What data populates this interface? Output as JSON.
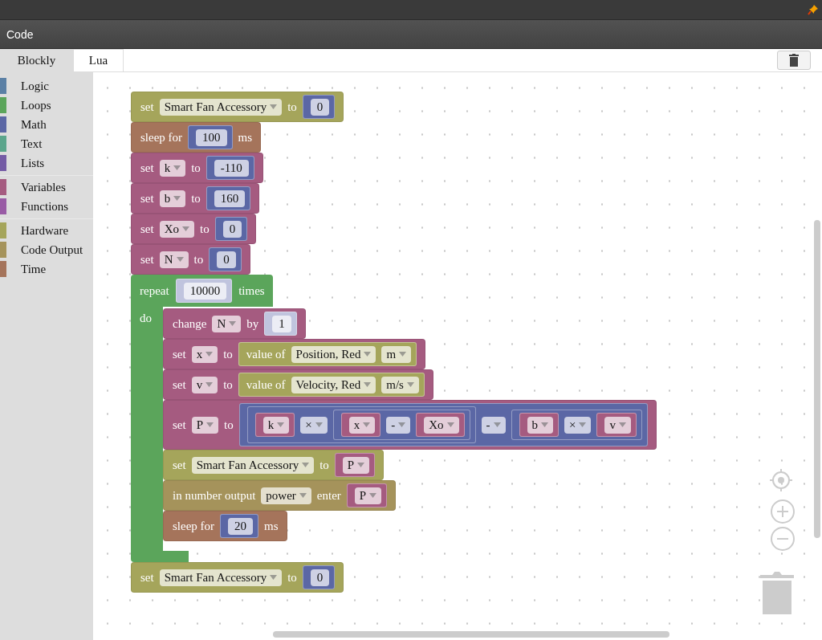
{
  "window": {
    "title": "Code"
  },
  "tabs": [
    {
      "label": "Blockly",
      "selected": true
    },
    {
      "label": "Lua",
      "selected": false
    }
  ],
  "sidebar": {
    "groups": [
      {
        "items": [
          {
            "label": "Logic",
            "color": "#5b80a5"
          },
          {
            "label": "Loops",
            "color": "#5ba55b"
          },
          {
            "label": "Math",
            "color": "#5b67a5"
          },
          {
            "label": "Text",
            "color": "#5ba58c"
          },
          {
            "label": "Lists",
            "color": "#745ba5"
          }
        ]
      },
      {
        "items": [
          {
            "label": "Variables",
            "color": "#a55b80"
          },
          {
            "label": "Functions",
            "color": "#995ba5"
          }
        ]
      },
      {
        "items": [
          {
            "label": "Hardware",
            "color": "#a5a55b"
          },
          {
            "label": "Code Output",
            "color": "#a5935b"
          },
          {
            "label": "Time",
            "color": "#a5745b"
          }
        ]
      }
    ]
  },
  "workspace": {
    "blocks": [
      {
        "kind": "statement",
        "color": "#a5a55b",
        "parts": [
          {
            "kind": "label",
            "text": "set"
          },
          {
            "kind": "dropdown",
            "text": "Smart Fan Accessory"
          },
          {
            "kind": "label",
            "text": "to"
          },
          {
            "kind": "value",
            "block": {
              "color": "#5b67a5",
              "parts": [
                {
                  "kind": "field",
                  "text": "0"
                }
              ]
            }
          }
        ]
      },
      {
        "kind": "statement",
        "color": "#a5745b",
        "parts": [
          {
            "kind": "label",
            "text": "sleep for"
          },
          {
            "kind": "value",
            "block": {
              "color": "#5b67a5",
              "parts": [
                {
                  "kind": "field",
                  "text": "100"
                }
              ]
            }
          },
          {
            "kind": "label",
            "text": "ms"
          }
        ]
      },
      {
        "kind": "statement",
        "color": "#a55b80",
        "parts": [
          {
            "kind": "label",
            "text": "set"
          },
          {
            "kind": "dropdown",
            "text": "k"
          },
          {
            "kind": "label",
            "text": "to"
          },
          {
            "kind": "value",
            "block": {
              "color": "#5b67a5",
              "parts": [
                {
                  "kind": "field",
                  "text": "-110"
                }
              ]
            }
          }
        ]
      },
      {
        "kind": "statement",
        "color": "#a55b80",
        "parts": [
          {
            "kind": "label",
            "text": "set"
          },
          {
            "kind": "dropdown",
            "text": "b"
          },
          {
            "kind": "label",
            "text": "to"
          },
          {
            "kind": "value",
            "block": {
              "color": "#5b67a5",
              "parts": [
                {
                  "kind": "field",
                  "text": "160"
                }
              ]
            }
          }
        ]
      },
      {
        "kind": "statement",
        "color": "#a55b80",
        "parts": [
          {
            "kind": "label",
            "text": "set"
          },
          {
            "kind": "dropdown",
            "text": "Xo"
          },
          {
            "kind": "label",
            "text": "to"
          },
          {
            "kind": "value",
            "block": {
              "color": "#5b67a5",
              "parts": [
                {
                  "kind": "field",
                  "text": "0"
                }
              ]
            }
          }
        ]
      },
      {
        "kind": "statement",
        "color": "#a55b80",
        "parts": [
          {
            "kind": "label",
            "text": "set"
          },
          {
            "kind": "dropdown",
            "text": "N"
          },
          {
            "kind": "label",
            "text": "to"
          },
          {
            "kind": "value",
            "block": {
              "color": "#5b67a5",
              "parts": [
                {
                  "kind": "field",
                  "text": "0"
                }
              ]
            }
          }
        ]
      },
      {
        "kind": "loop",
        "color": "#5ba55b",
        "parts": [
          {
            "kind": "label",
            "text": "repeat"
          },
          {
            "kind": "value",
            "block": {
              "color": "#c0c4de",
              "parts": [
                {
                  "kind": "field",
                  "text": "10000"
                }
              ]
            }
          },
          {
            "kind": "label",
            "text": "times"
          }
        ],
        "do_label": "do",
        "body": [
          {
            "kind": "statement",
            "color": "#a55b80",
            "parts": [
              {
                "kind": "label",
                "text": "change"
              },
              {
                "kind": "dropdown",
                "text": "N"
              },
              {
                "kind": "label",
                "text": "by"
              },
              {
                "kind": "value",
                "block": {
                  "color": "#c0c4de",
                  "parts": [
                    {
                      "kind": "field",
                      "text": "1"
                    }
                  ]
                }
              }
            ]
          },
          {
            "kind": "statement",
            "color": "#a55b80",
            "parts": [
              {
                "kind": "label",
                "text": "set"
              },
              {
                "kind": "dropdown",
                "text": "x"
              },
              {
                "kind": "label",
                "text": "to"
              },
              {
                "kind": "value",
                "block": {
                  "color": "#a5a55b",
                  "parts": [
                    {
                      "kind": "label",
                      "text": "value of"
                    },
                    {
                      "kind": "dropdown",
                      "text": "Position, Red"
                    },
                    {
                      "kind": "dropdown",
                      "text": "m"
                    }
                  ]
                }
              }
            ]
          },
          {
            "kind": "statement",
            "color": "#a55b80",
            "parts": [
              {
                "kind": "label",
                "text": "set"
              },
              {
                "kind": "dropdown",
                "text": "v"
              },
              {
                "kind": "label",
                "text": "to"
              },
              {
                "kind": "value",
                "block": {
                  "color": "#a5a55b",
                  "parts": [
                    {
                      "kind": "label",
                      "text": "value of"
                    },
                    {
                      "kind": "dropdown",
                      "text": "Velocity, Red"
                    },
                    {
                      "kind": "dropdown",
                      "text": "m/s"
                    }
                  ]
                }
              }
            ]
          },
          {
            "kind": "statement",
            "color": "#a55b80",
            "parts": [
              {
                "kind": "label",
                "text": "set"
              },
              {
                "kind": "dropdown",
                "text": "P"
              },
              {
                "kind": "label",
                "text": "to"
              },
              {
                "kind": "value",
                "block": {
                  "color": "#5b67a5",
                  "parts": [
                    {
                      "kind": "value",
                      "block": {
                        "color": "#5b67a5",
                        "parts": [
                          {
                            "kind": "value",
                            "block": {
                              "color": "#a55b80",
                              "parts": [
                                {
                                  "kind": "dropdown",
                                  "text": "k"
                                }
                              ]
                            }
                          },
                          {
                            "kind": "dropdown",
                            "text": "×"
                          },
                          {
                            "kind": "value",
                            "block": {
                              "color": "#5b67a5",
                              "parts": [
                                {
                                  "kind": "value",
                                  "block": {
                                    "color": "#a55b80",
                                    "parts": [
                                      {
                                        "kind": "dropdown",
                                        "text": "x"
                                      }
                                    ]
                                  }
                                },
                                {
                                  "kind": "dropdown",
                                  "text": "-"
                                },
                                {
                                  "kind": "value",
                                  "block": {
                                    "color": "#a55b80",
                                    "parts": [
                                      {
                                        "kind": "dropdown",
                                        "text": "Xo"
                                      }
                                    ]
                                  }
                                }
                              ]
                            }
                          }
                        ]
                      }
                    },
                    {
                      "kind": "dropdown",
                      "text": "-"
                    },
                    {
                      "kind": "value",
                      "block": {
                        "color": "#5b67a5",
                        "parts": [
                          {
                            "kind": "value",
                            "block": {
                              "color": "#a55b80",
                              "parts": [
                                {
                                  "kind": "dropdown",
                                  "text": "b"
                                }
                              ]
                            }
                          },
                          {
                            "kind": "dropdown",
                            "text": "×"
                          },
                          {
                            "kind": "value",
                            "block": {
                              "color": "#a55b80",
                              "parts": [
                                {
                                  "kind": "dropdown",
                                  "text": "v"
                                }
                              ]
                            }
                          }
                        ]
                      }
                    }
                  ]
                }
              }
            ]
          },
          {
            "kind": "statement",
            "color": "#a5a55b",
            "parts": [
              {
                "kind": "label",
                "text": "set"
              },
              {
                "kind": "dropdown",
                "text": "Smart Fan Accessory"
              },
              {
                "kind": "label",
                "text": "to"
              },
              {
                "kind": "value",
                "block": {
                  "color": "#a55b80",
                  "parts": [
                    {
                      "kind": "dropdown",
                      "text": "P"
                    }
                  ]
                }
              }
            ]
          },
          {
            "kind": "statement",
            "color": "#a5935b",
            "parts": [
              {
                "kind": "label",
                "text": "in number output"
              },
              {
                "kind": "dropdown",
                "text": "power"
              },
              {
                "kind": "label",
                "text": "enter"
              },
              {
                "kind": "value",
                "block": {
                  "color": "#a55b80",
                  "parts": [
                    {
                      "kind": "dropdown",
                      "text": "P"
                    }
                  ]
                }
              }
            ]
          },
          {
            "kind": "statement",
            "color": "#a5745b",
            "parts": [
              {
                "kind": "label",
                "text": "sleep for"
              },
              {
                "kind": "value",
                "block": {
                  "color": "#5b67a5",
                  "parts": [
                    {
                      "kind": "field",
                      "text": "20"
                    }
                  ]
                }
              },
              {
                "kind": "label",
                "text": "ms"
              }
            ]
          }
        ]
      },
      {
        "kind": "statement",
        "color": "#a5a55b",
        "parts": [
          {
            "kind": "label",
            "text": "set"
          },
          {
            "kind": "dropdown",
            "text": "Smart Fan Accessory"
          },
          {
            "kind": "label",
            "text": "to"
          },
          {
            "kind": "value",
            "block": {
              "color": "#5b67a5",
              "parts": [
                {
                  "kind": "field",
                  "text": "0"
                }
              ]
            }
          }
        ]
      }
    ]
  }
}
